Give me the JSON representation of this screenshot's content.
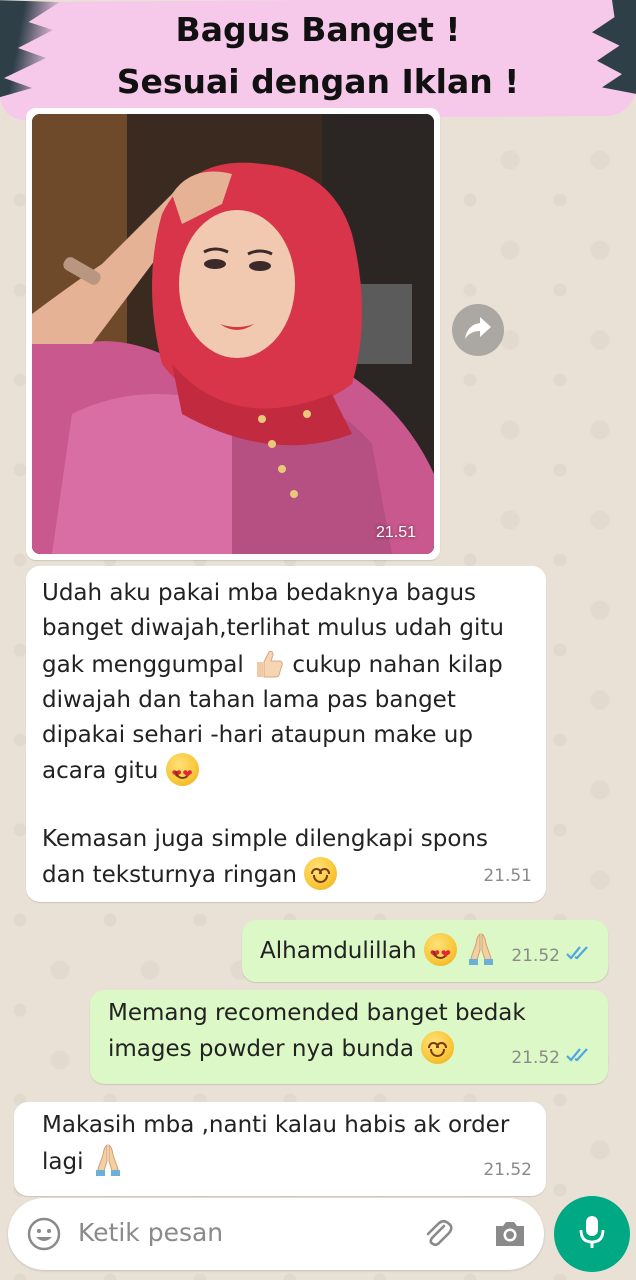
{
  "banner": {
    "line1": "Bagus Banget !",
    "line2": "Sesuai dengan Iklan !",
    "color": "#f6c8e9"
  },
  "messages": {
    "photo": {
      "time": "21.51"
    },
    "m1": {
      "p1a": "Udah aku pakai mba bedaknya bagus",
      "p1b": "banget diwajah,terlihat mulus udah gitu",
      "p1c": "gak menggumpal",
      "p1d": "cukup nahan kilap",
      "p1e": "diwajah dan tahan lama pas banget",
      "p1f": "dipakai sehari -hari ataupun make up",
      "p1g": "acara gitu",
      "p2a": "Kemasan juga simple dilengkapi spons",
      "p2b": "dan teksturnya ringan",
      "time": "21.51"
    },
    "m2": {
      "text": "Alhamdulillah",
      "time": "21.52"
    },
    "m3": {
      "line1": "Memang recomended banget bedak",
      "line2": "images powder nya bunda",
      "time": "21.52"
    },
    "m4": {
      "line1": "Makasih mba ,nanti kalau habis ak order",
      "line2": "lagi",
      "time": "21.52"
    }
  },
  "input": {
    "placeholder": "Ketik pesan"
  },
  "icons": [
    "forward-icon",
    "emoji-icon",
    "attach-icon",
    "camera-icon",
    "mic-icon",
    "double-check-icon"
  ],
  "colors": {
    "incoming": "#ffffff",
    "outgoing": "#dcf8c6",
    "accent": "#00a884",
    "read_ticks": "#4fa8e0"
  }
}
